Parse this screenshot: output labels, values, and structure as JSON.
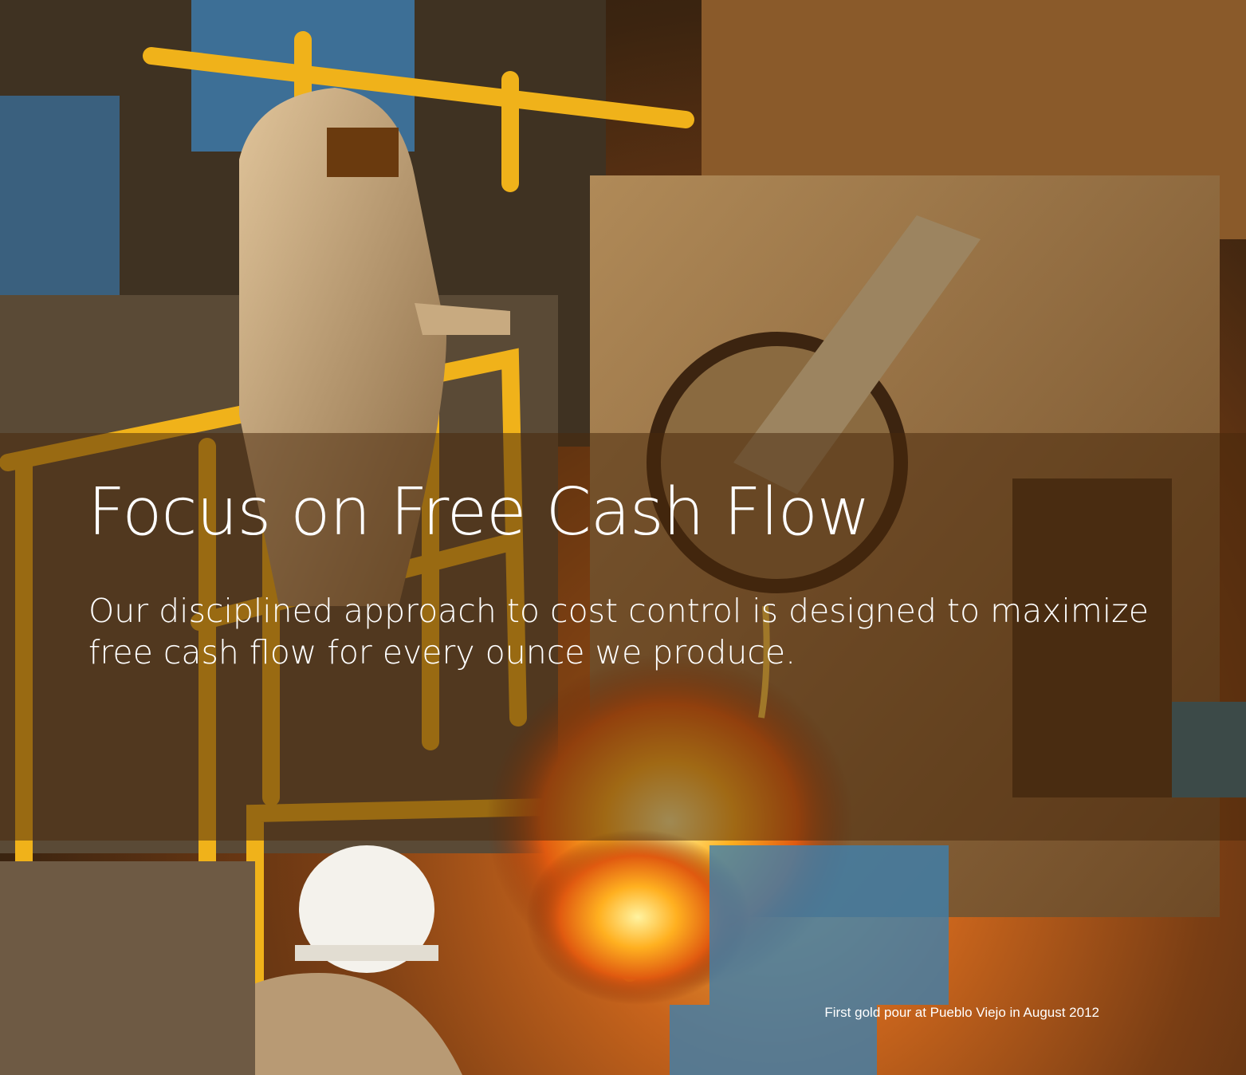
{
  "page": {
    "headline": "Focus on Free Cash Flow",
    "subhead": "Our disciplined approach to cost control is designed to maximize free cash flow for every ounce we produce.",
    "caption": "First gold pour at Pueblo Viejo in August 2012"
  },
  "colors": {
    "overlay": "#482810",
    "text": "#ffffff",
    "railing": "#f0b21a",
    "molten": "#f59a22",
    "steel_blue": "#2f78a8"
  }
}
